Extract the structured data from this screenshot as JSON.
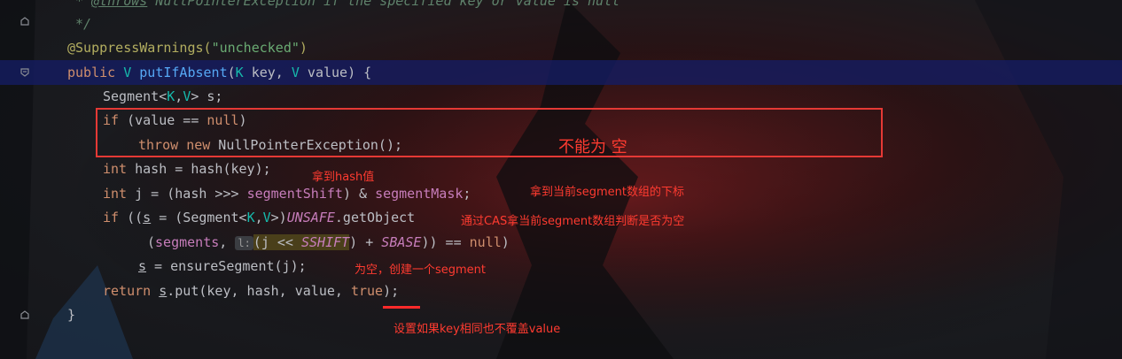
{
  "editor": {
    "comment_throws_tag": "@throws",
    "comment_throws_text": " NullPointerException if the specified key or value is null",
    "comment_star": " * ",
    "comment_end": " */",
    "annotation": "@SuppressWarnings(",
    "annotation_arg": "\"unchecked\"",
    "annotation_close": ")",
    "sig_public": "public",
    "sig_type": "V",
    "sig_name": "putIfAbsent",
    "sig_p1_type": "K",
    "sig_p1": " key, ",
    "sig_p2_type": "V",
    "sig_p2": " value) {",
    "l_seg_decl": "Segment<",
    "l_seg_k": "K",
    "l_seg_comma": ",",
    "l_seg_v": "V",
    "l_seg_rest": "> s;",
    "l_if_kw": "if",
    "l_if_cond": " (value == ",
    "l_if_null": "null",
    "l_if_close": ")",
    "l_throw_kw": "throw",
    "l_new_kw": "new",
    "l_throw_rest": " NullPointerException();",
    "l_int1": "int",
    "l_hash": " hash = hash(key);",
    "l_int2": "int",
    "l_j1": " j = (hash >>> ",
    "l_j_shift": "segmentShift",
    "l_j2": ") & ",
    "l_j_mask": "segmentMask",
    "l_j3": ";",
    "l_if2_kw": "if",
    "l_if2_a": " ((",
    "l_if2_s": "s",
    "l_if2_b": " = (Segment<",
    "l_if2_k": "K",
    "l_if2_c": ",",
    "l_if2_v": "V",
    "l_if2_d": ">)",
    "l_if2_unsafe": "UNSAFE",
    "l_if2_e": ".getObject",
    "l_seg_open": "(",
    "l_segments": "segments",
    "l_seg_comma2": ", ",
    "l_hint": "l:",
    "l_seg_j": "(j << ",
    "l_sshift": "SSHIFT",
    "l_seg_plus": ") + ",
    "l_sbase": "SBASE",
    "l_seg_eq": ")) == ",
    "l_seg_null": "null",
    "l_seg_close": ")",
    "l_ens_s": "s",
    "l_ens_rest": " = ensureSegment(j);",
    "l_ret_kw": "return",
    "l_ret_s": "s",
    "l_ret_put": ".put(key, hash, value, ",
    "l_ret_true": "true",
    "l_ret_end": ");",
    "l_close": "}"
  },
  "notes": {
    "not_null": "不能为 空",
    "get_hash": "拿到hash值",
    "get_index": "拿到当前segment数组的下标",
    "cas_check": "通过CAS拿当前segment数组判断是否为空",
    "create_seg": "为空，创建一个segment",
    "no_overwrite": "设置如果key相同也不覆盖value"
  },
  "colors": {
    "highlight_line": "#141c64",
    "annotation_red": "#ff3b30",
    "keyword": "#cf8e6d",
    "field": "#c77dbb"
  },
  "icons": [
    "fold-icon",
    "breakpoint-gutter-icon"
  ]
}
